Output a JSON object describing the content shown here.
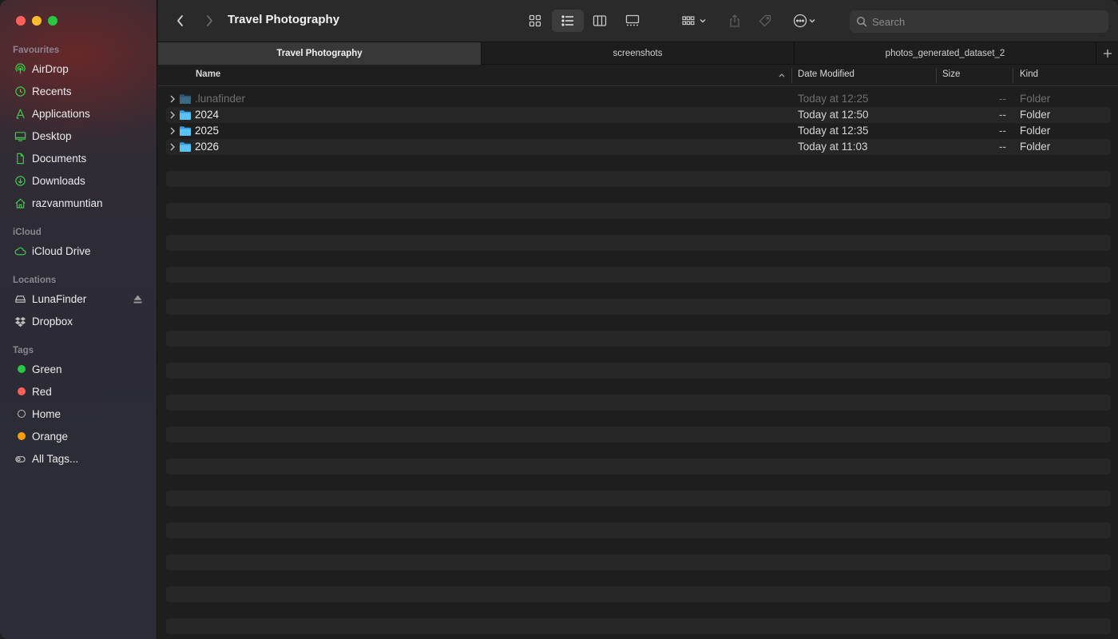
{
  "window": {
    "title": "Travel Photography"
  },
  "sidebar": {
    "favourites_label": "Favourites",
    "favourites": [
      {
        "label": "AirDrop",
        "icon": "airdrop-icon"
      },
      {
        "label": "Recents",
        "icon": "clock-icon"
      },
      {
        "label": "Applications",
        "icon": "applications-icon"
      },
      {
        "label": "Desktop",
        "icon": "desktop-icon"
      },
      {
        "label": "Documents",
        "icon": "document-icon"
      },
      {
        "label": "Downloads",
        "icon": "download-icon"
      },
      {
        "label": "razvanmuntian",
        "icon": "home-icon"
      }
    ],
    "icloud_label": "iCloud",
    "icloud": [
      {
        "label": "iCloud Drive",
        "icon": "cloud-icon"
      }
    ],
    "locations_label": "Locations",
    "locations": [
      {
        "label": "LunaFinder",
        "icon": "drive-icon"
      },
      {
        "label": "Dropbox",
        "icon": "dropbox-icon"
      }
    ],
    "tags_label": "Tags",
    "tags": [
      {
        "label": "Green",
        "color": "#28c840"
      },
      {
        "label": "Red",
        "color": "#fe5f57"
      },
      {
        "label": "Home",
        "color": "hollow"
      },
      {
        "label": "Orange",
        "color": "#f59e0b"
      },
      {
        "label": "All Tags...",
        "color": "all-tags-icon"
      }
    ],
    "accent_color": "#3ec64a"
  },
  "toolbar": {
    "search_placeholder": "Search",
    "view_mode": "list"
  },
  "tabs": [
    {
      "label": "Travel Photography",
      "active": true
    },
    {
      "label": "screenshots",
      "active": false
    },
    {
      "label": "photos_generated_dataset_2",
      "active": false
    }
  ],
  "columns": {
    "name": "Name",
    "date": "Date Modified",
    "size": "Size",
    "kind": "Kind"
  },
  "files": [
    {
      "name": ".lunafinder",
      "date": "Today at 12:25",
      "size": "--",
      "kind": "Folder",
      "hidden": true
    },
    {
      "name": "2024",
      "date": "Today at 12:50",
      "size": "--",
      "kind": "Folder",
      "hidden": false
    },
    {
      "name": "2025",
      "date": "Today at 12:35",
      "size": "--",
      "kind": "Folder",
      "hidden": false
    },
    {
      "name": "2026",
      "date": "Today at 11:03",
      "size": "--",
      "kind": "Folder",
      "hidden": false
    }
  ]
}
